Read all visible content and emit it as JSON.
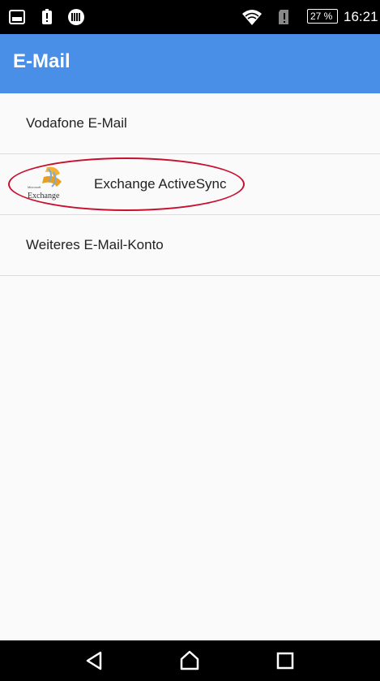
{
  "status_bar": {
    "battery_percent": "27 %",
    "time": "16:21",
    "icons": [
      "screenshot-icon",
      "battery-alert-icon",
      "data-saver-icon",
      "wifi-icon",
      "sim-alert-icon",
      "battery-icon"
    ]
  },
  "app_bar": {
    "title": "E-Mail",
    "color": "#4a8fe7"
  },
  "accounts": [
    {
      "label": "Vodafone E-Mail"
    },
    {
      "label": "Exchange ActiveSync",
      "icon": "exchange-logo-icon",
      "logo_text": "Exchange",
      "logo_small": "Microsoft",
      "highlight_color": "#c8102e"
    },
    {
      "label": "Weiteres E-Mail-Konto"
    }
  ],
  "nav_bar": {
    "icons": [
      "back-icon",
      "home-icon",
      "recents-icon"
    ]
  }
}
